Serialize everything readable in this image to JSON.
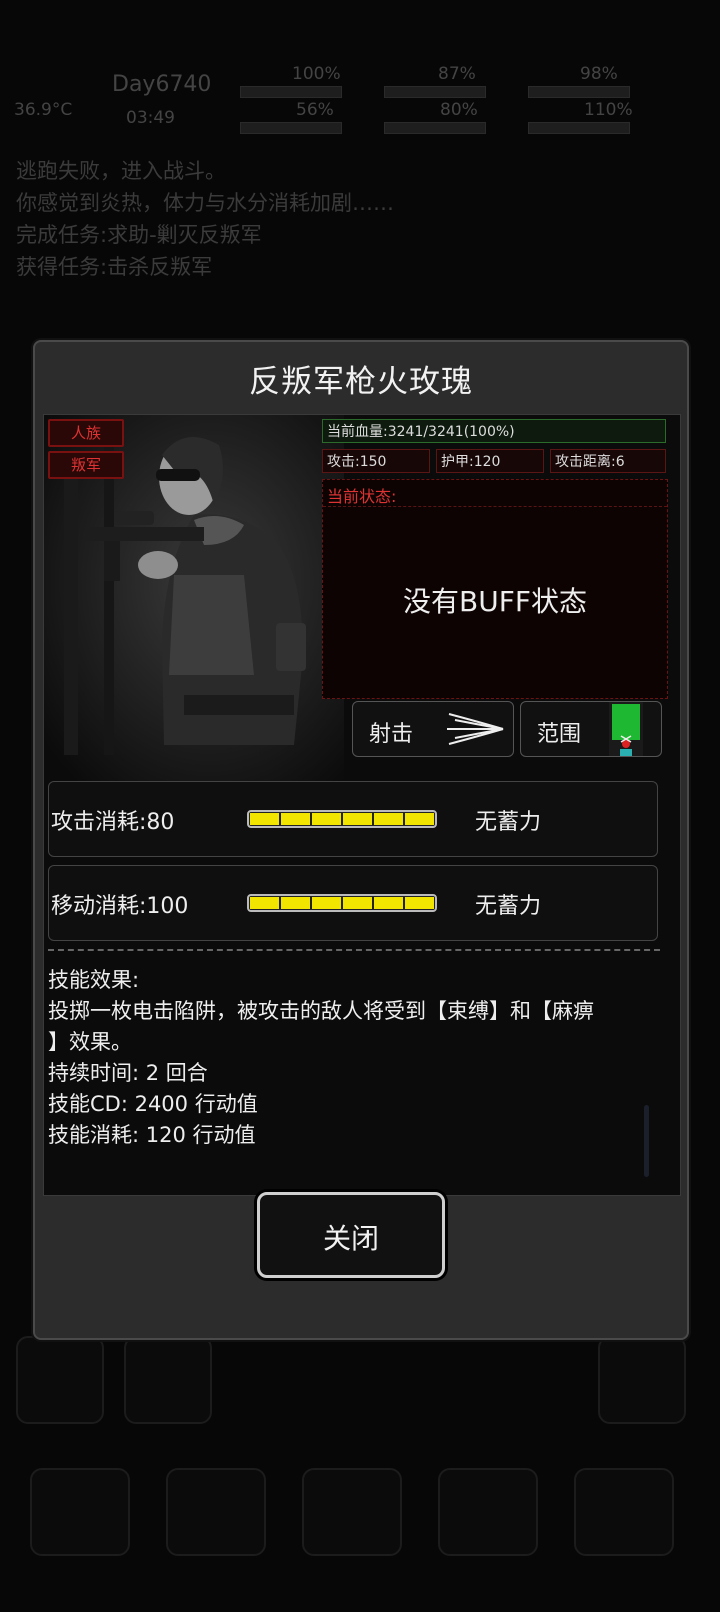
{
  "background": {
    "day": "Day6740",
    "time": "03:49",
    "temperature": "36.9°C",
    "stats": [
      "100%",
      "87%",
      "98%",
      "56%",
      "80%",
      "110%"
    ],
    "log": [
      "逃跑失败，进入战斗。",
      "你感觉到炎热，体力与水分消耗加剧……",
      "完成任务:求助-剿灭反叛军",
      "获得任务:击杀反叛军"
    ]
  },
  "dialog": {
    "title": "反叛军枪火玫瑰",
    "tags": [
      "人族",
      "叛军"
    ],
    "hp": "当前血量:3241/3241(100%)",
    "attack": "攻击:150",
    "armor": "护甲:120",
    "range": "攻击距离:6",
    "status_label": "当前状态:",
    "no_buff": "没有BUFF状态",
    "skill_shoot": "射击",
    "skill_range": "范围",
    "attack_cost": "攻击消耗:80",
    "move_cost": "移动消耗:100",
    "no_charge": "无蓄力",
    "desc_lines": [
      "技能效果:",
      " 投掷一枚电击陷阱，被攻击的敌人将受到【束缚】和【麻痹",
      "】效果。",
      "持续时间: 2 回合",
      "技能CD: 2400 行动值",
      "技能消耗: 120 行动值"
    ],
    "close": "关闭"
  },
  "colors": {
    "accent_red": "#cc2222",
    "hp_green": "#2c6a2c",
    "bar_yellow": "#f2e600"
  }
}
